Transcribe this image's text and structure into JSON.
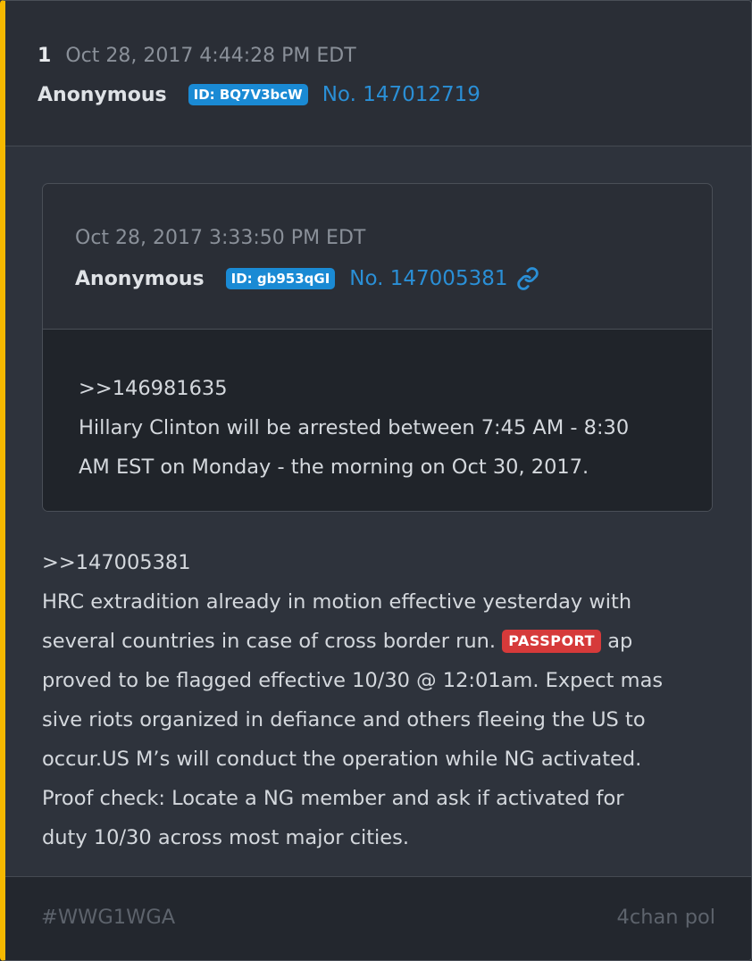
{
  "post": {
    "number": "1",
    "timestamp": "Oct 28, 2017 4:44:28 PM EDT",
    "author": "Anonymous",
    "id_badge": "ID: BQ7V3bcW",
    "post_no": "No. 147012719",
    "accent_color": "#f5b800"
  },
  "quoted": {
    "timestamp": "Oct 28, 2017 3:33:50 PM EDT",
    "author": "Anonymous",
    "id_badge": "ID: gb953qGI",
    "post_no": "No. 147005381",
    "link_icon": "link-icon",
    "lines": [
      ">>146981635",
      "Hillary Clinton will be arrested between 7:45 AM - 8:30",
      "AM EST on Monday - the morning on Oct 30, 2017."
    ]
  },
  "body": {
    "line1": ">>147005381",
    "line2": "HRC extradition already in motion effective yesterday with",
    "line3_before": "several countries in case of cross border run. ",
    "passport_badge": "PASSPORT",
    "line3_after": " ap",
    "line4": "proved to be flagged effective 10/30 @ 12:01am. Expect mas",
    "line5": "sive riots organized in defiance and others fleeing the US to",
    "line6": "occur.US M’s will conduct the operation while NG activated.",
    "line7": "Proof check: Locate a NG member and ask if activated for",
    "line8": "duty 10/30 across most major cities."
  },
  "footer": {
    "tag": "#WWG1WGA",
    "source": "4chan pol"
  }
}
